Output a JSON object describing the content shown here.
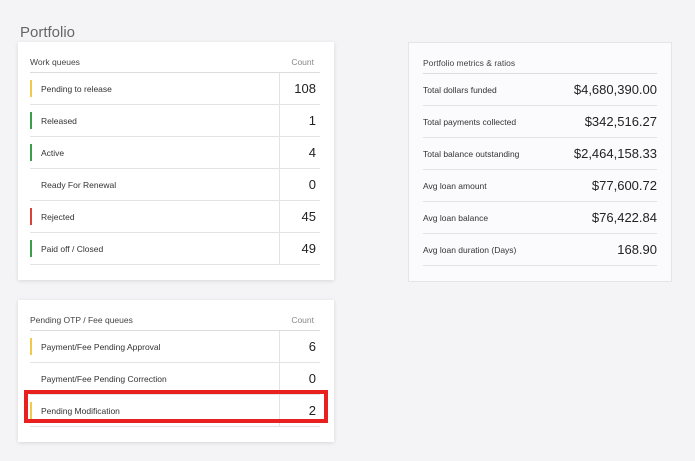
{
  "page": {
    "title": "Portfolio"
  },
  "colors": {
    "yellow": "#f2c94c",
    "green": "#3a9e4f",
    "red": "#d9413b",
    "highlight": "#e8201f"
  },
  "work_queues": {
    "header": "Work queues",
    "count_header": "Count",
    "rows": [
      {
        "label": "Pending to release",
        "count": "108",
        "bar": "#f2c94c"
      },
      {
        "label": "Released",
        "count": "1",
        "bar": "#3a9e4f"
      },
      {
        "label": "Active",
        "count": "4",
        "bar": "#3a9e4f"
      },
      {
        "label": "Ready For Renewal",
        "count": "0",
        "bar": ""
      },
      {
        "label": "Rejected",
        "count": "45",
        "bar": "#d9413b"
      },
      {
        "label": "Paid off / Closed",
        "count": "49",
        "bar": "#3a9e4f"
      }
    ]
  },
  "metrics": {
    "header": "Portfolio metrics & ratios",
    "rows": [
      {
        "label": "Total dollars funded",
        "value": "$4,680,390.00"
      },
      {
        "label": "Total payments collected",
        "value": "$342,516.27"
      },
      {
        "label": "Total balance outstanding",
        "value": "$2,464,158.33"
      },
      {
        "label": "Avg loan amount",
        "value": "$77,600.72"
      },
      {
        "label": "Avg loan balance",
        "value": "$76,422.84"
      },
      {
        "label": "Avg loan duration (Days)",
        "value": "168.90"
      }
    ]
  },
  "otp_queues": {
    "header": "Pending OTP / Fee queues",
    "count_header": "Count",
    "rows": [
      {
        "label": "Payment/Fee Pending Approval",
        "count": "6",
        "bar": "#f2c94c"
      },
      {
        "label": "Payment/Fee Pending Correction",
        "count": "0",
        "bar": ""
      },
      {
        "label": "Pending Modification",
        "count": "2",
        "bar": "#f2c94c"
      }
    ]
  }
}
